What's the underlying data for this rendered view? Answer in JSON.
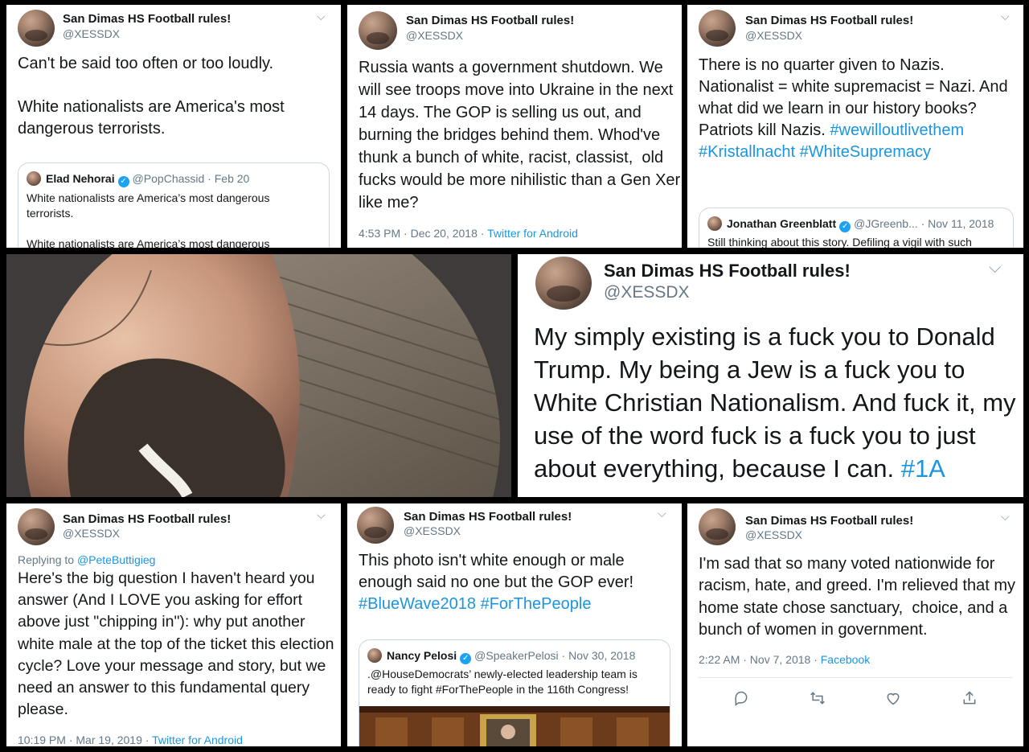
{
  "author": {
    "name": "San Dimas HS Football rules!",
    "handle": "@XESSDX"
  },
  "tweets": {
    "t1": {
      "text": "Can't be said too often or too loudly.\n\nWhite nationalists are America's most dangerous terrorists.",
      "quote": {
        "name": "Elad Nehorai",
        "handle": "@PopChassid · Feb 20",
        "text": "White nationalists are America’s most dangerous terrorists.\n\nWhite nationalists are America’s most dangerous"
      }
    },
    "t2": {
      "text": "Russia wants a government shutdown. We will see troops move into Ukraine in the next 14 days. The GOP is selling us out, and burning the bridges behind them. Whod've thunk a bunch of white, racist, classist,  old fucks would be more nihilistic than a Gen Xer like me?",
      "time": "4:53 PM · Dec 20, 2018 · ",
      "source": "Twitter for Android"
    },
    "t3": {
      "text": "There is no quarter given to Nazis. Nationalist = white supremacist = Nazi. And what did we learn in our history books? Patriots kill Nazis. ",
      "hashtags": "#wewilloutlivethem #Kristallnacht #WhiteSupremacy",
      "quote": {
        "name": "Jonathan Greenblatt",
        "handle": "@JGreenb... · Nov 11, 2018",
        "text": "Still thinking about this story. Defiling a vigil with such"
      }
    },
    "t4": {
      "text": "My simply existing is a fuck you to Donald Trump. My being a Jew is a fuck you to White Christian Nationalism. And fuck it, my use of the word fuck is a fuck you to just about everything, because I can. ",
      "hashtag": "#1A"
    },
    "t5": {
      "replying_prefix": "Replying to ",
      "replying_to": "@PeteButtigieg",
      "text": "Here's the big question I haven't heard you answer (And I LOVE you asking for effort above just \"chipping in\"): why put another white male at the top of the ticket this election cycle? Love your message and story, but we need an answer to this fundamental query please.",
      "time": "10:19 PM · Mar 19, 2019 · ",
      "source": "Twitter for Android"
    },
    "t6": {
      "text": "This photo isn't white enough or male enough said no one but the GOP ever! ",
      "hashtags": "#BlueWave2018 #ForThePeople",
      "quote": {
        "name": "Nancy Pelosi",
        "handle": "@SpeakerPelosi · Nov 30, 2018",
        "text": ".@HouseDemocrats’ newly-elected leadership team is ready to fight #ForThePeople in the 116th Congress!"
      }
    },
    "t7": {
      "text": "I'm sad that so many voted nationwide for racism, hate, and greed. I'm relieved that my home state chose sanctuary,  choice, and a bunch of women in government.",
      "time": "2:22 AM · Nov 7, 2018 · ",
      "source": "Facebook"
    }
  },
  "icons": [
    "chevron-down-icon",
    "verified-icon",
    "reply-icon",
    "retweet-icon",
    "like-icon",
    "share-icon"
  ],
  "colors": {
    "link": "#1b95e0",
    "text": "#14171a",
    "secondary": "#657786",
    "verified": "#1da1f2",
    "background": "#000000"
  }
}
